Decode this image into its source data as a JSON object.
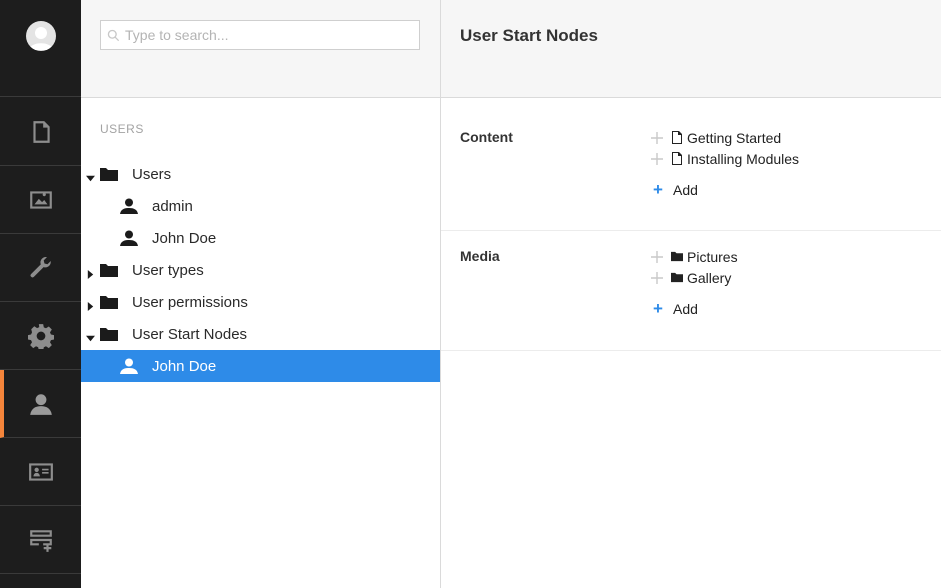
{
  "search": {
    "placeholder": "Type to search..."
  },
  "tree": {
    "title": "USERS",
    "items": [
      {
        "label": "Users"
      },
      {
        "label": "admin"
      },
      {
        "label": "John Doe"
      },
      {
        "label": "User types"
      },
      {
        "label": "User permissions"
      },
      {
        "label": "User Start Nodes"
      },
      {
        "label": "John Doe"
      }
    ]
  },
  "main": {
    "title": "User Start Nodes",
    "content": {
      "label": "Content",
      "nodes": [
        "Getting Started",
        "Installing Modules"
      ],
      "add_label": "Add"
    },
    "media": {
      "label": "Media",
      "nodes": [
        "Pictures",
        "Gallery"
      ],
      "add_label": "Add"
    }
  },
  "colors": {
    "appbar_bg": "#1d1d1d",
    "active_accent": "#f5853b",
    "selection": "#2e8be8",
    "add_plus": "#2e8be8"
  },
  "icons": {
    "appbar": [
      "avatar-icon",
      "document-icon",
      "image-icon",
      "wrench-icon",
      "gear-icon",
      "user-icon",
      "id-card-icon",
      "forms-icon"
    ]
  }
}
